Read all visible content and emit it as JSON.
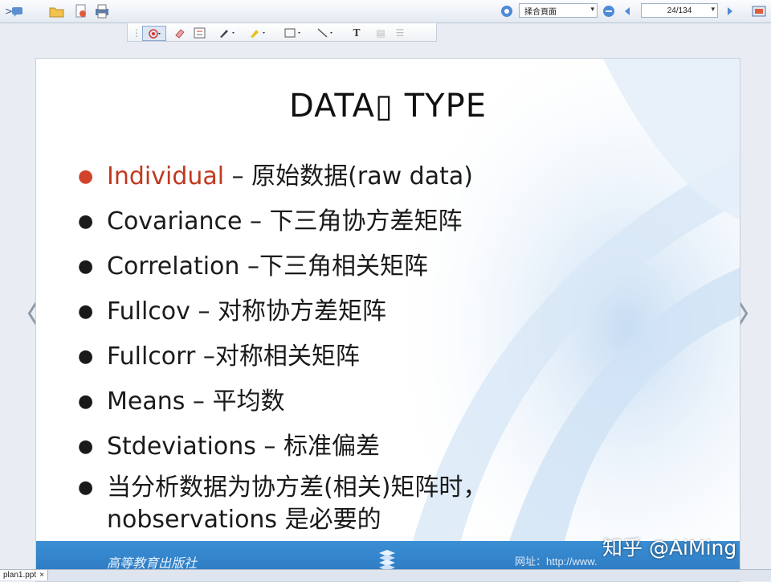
{
  "toolbar": {
    "left_glyph": ">",
    "view_mode": "揉合頁面",
    "page_indicator": "24/134",
    "dropdown_glyph": "▾"
  },
  "slide": {
    "title": "DATA▯  TYPE",
    "bullets": [
      {
        "term": "Individual",
        "desc": " – 原始数据(raw data)",
        "accent": true
      },
      {
        "term": "Covariance",
        "desc": " – 下三角协方差矩阵",
        "accent": false
      },
      {
        "term": "Correlation",
        "desc": " –下三角相关矩阵",
        "accent": false
      },
      {
        "term": "Fullcov",
        "desc": " – 对称协方差矩阵",
        "accent": false
      },
      {
        "term": "Fullcorr",
        "desc": " –对称相关矩阵",
        "accent": false
      },
      {
        "term": "Means",
        "desc": " – 平均数",
        "accent": false
      },
      {
        "term": "Stdeviations",
        "desc": " – 标准偏差",
        "accent": false
      },
      {
        "line1": "当分析数据为协方差(相关)矩阵时，",
        "line2": "nobservations 是必要的"
      }
    ],
    "footer_left": "高等教育出版社",
    "footer_url": "网址：http://www.",
    "watermark": "知乎 @AiMing"
  },
  "nav": {
    "prev": "〈",
    "next": "〉"
  },
  "status": {
    "file_tab": "plan1.ppt",
    "close": "×"
  },
  "colors": {
    "accent_red": "#c0391f",
    "footer_blue": "#2a76be"
  }
}
